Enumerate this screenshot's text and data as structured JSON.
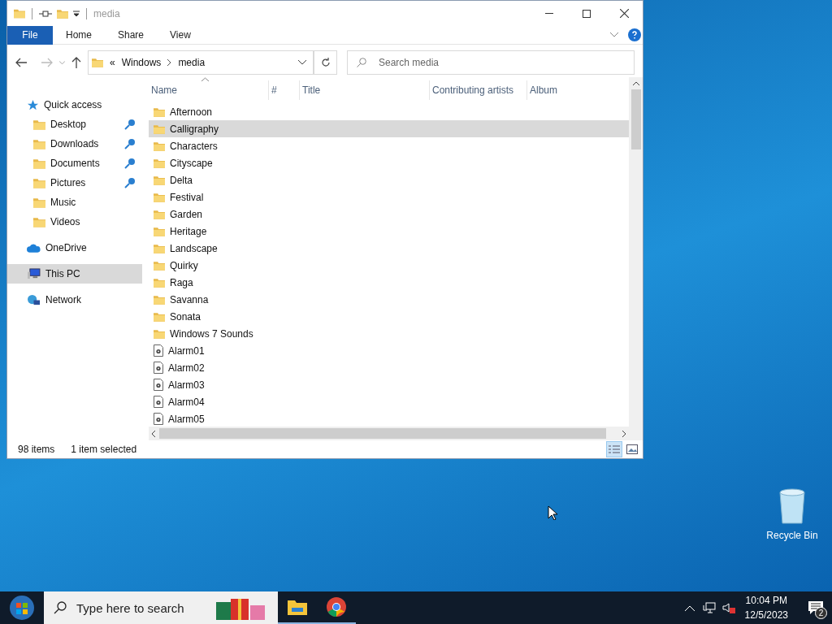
{
  "window": {
    "title": "media"
  },
  "ribbon_tabs": [
    {
      "label": "File",
      "selected": true
    },
    {
      "label": "Home",
      "selected": false
    },
    {
      "label": "Share",
      "selected": false
    },
    {
      "label": "View",
      "selected": false
    }
  ],
  "address": {
    "overflow": "«",
    "path": [
      "Windows",
      "media"
    ]
  },
  "search": {
    "placeholder": "Search media"
  },
  "nav": [
    {
      "label": "Quick access",
      "kind": "star",
      "selected": false,
      "children": [
        {
          "label": "Desktop",
          "kind": "folder",
          "pinned": true,
          "selected": false
        },
        {
          "label": "Downloads",
          "kind": "folder",
          "pinned": true,
          "selected": false
        },
        {
          "label": "Documents",
          "kind": "folder",
          "pinned": true,
          "selected": false
        },
        {
          "label": "Pictures",
          "kind": "folder",
          "pinned": true,
          "selected": false
        },
        {
          "label": "Music",
          "kind": "folder",
          "pinned": false,
          "selected": false
        },
        {
          "label": "Videos",
          "kind": "folder",
          "pinned": false,
          "selected": false
        }
      ]
    },
    {
      "label": "OneDrive",
      "kind": "cloud",
      "selected": false
    },
    {
      "label": "This PC",
      "kind": "pc",
      "selected": true
    },
    {
      "label": "Network",
      "kind": "network",
      "selected": false
    }
  ],
  "columns": [
    {
      "label": "Name",
      "sorted": true
    },
    {
      "label": "#",
      "sorted": false
    },
    {
      "label": "Title",
      "sorted": false
    },
    {
      "label": "Contributing artists",
      "sorted": false
    },
    {
      "label": "Album",
      "sorted": false
    }
  ],
  "files": [
    {
      "name": "Afternoon",
      "kind": "folder",
      "selected": false
    },
    {
      "name": "Calligraphy",
      "kind": "folder",
      "selected": true
    },
    {
      "name": "Characters",
      "kind": "folder",
      "selected": false
    },
    {
      "name": "Cityscape",
      "kind": "folder",
      "selected": false
    },
    {
      "name": "Delta",
      "kind": "folder",
      "selected": false
    },
    {
      "name": "Festival",
      "kind": "folder",
      "selected": false
    },
    {
      "name": "Garden",
      "kind": "folder",
      "selected": false
    },
    {
      "name": "Heritage",
      "kind": "folder",
      "selected": false
    },
    {
      "name": "Landscape",
      "kind": "folder",
      "selected": false
    },
    {
      "name": "Quirky",
      "kind": "folder",
      "selected": false
    },
    {
      "name": "Raga",
      "kind": "folder",
      "selected": false
    },
    {
      "name": "Savanna",
      "kind": "folder",
      "selected": false
    },
    {
      "name": "Sonata",
      "kind": "folder",
      "selected": false
    },
    {
      "name": "Windows 7 Sounds",
      "kind": "folder",
      "selected": false
    },
    {
      "name": "Alarm01",
      "kind": "audio",
      "selected": false
    },
    {
      "name": "Alarm02",
      "kind": "audio",
      "selected": false
    },
    {
      "name": "Alarm03",
      "kind": "audio",
      "selected": false
    },
    {
      "name": "Alarm04",
      "kind": "audio",
      "selected": false
    },
    {
      "name": "Alarm05",
      "kind": "audio",
      "selected": false
    }
  ],
  "status_bar": {
    "item_count": "98 items",
    "selection": "1 item selected"
  },
  "view_buttons": [
    {
      "kind": "details",
      "selected": true
    },
    {
      "kind": "thumbnails",
      "selected": false
    }
  ],
  "desktop_icons": [
    {
      "label": "Recycle Bin"
    }
  ],
  "taskbar": {
    "search_placeholder": "Type here to search",
    "apps": [
      {
        "kind": "explorer",
        "running": true
      },
      {
        "kind": "chrome",
        "running": true
      }
    ],
    "time": "10:04 PM",
    "date": "12/5/2023",
    "notifications": "2"
  }
}
